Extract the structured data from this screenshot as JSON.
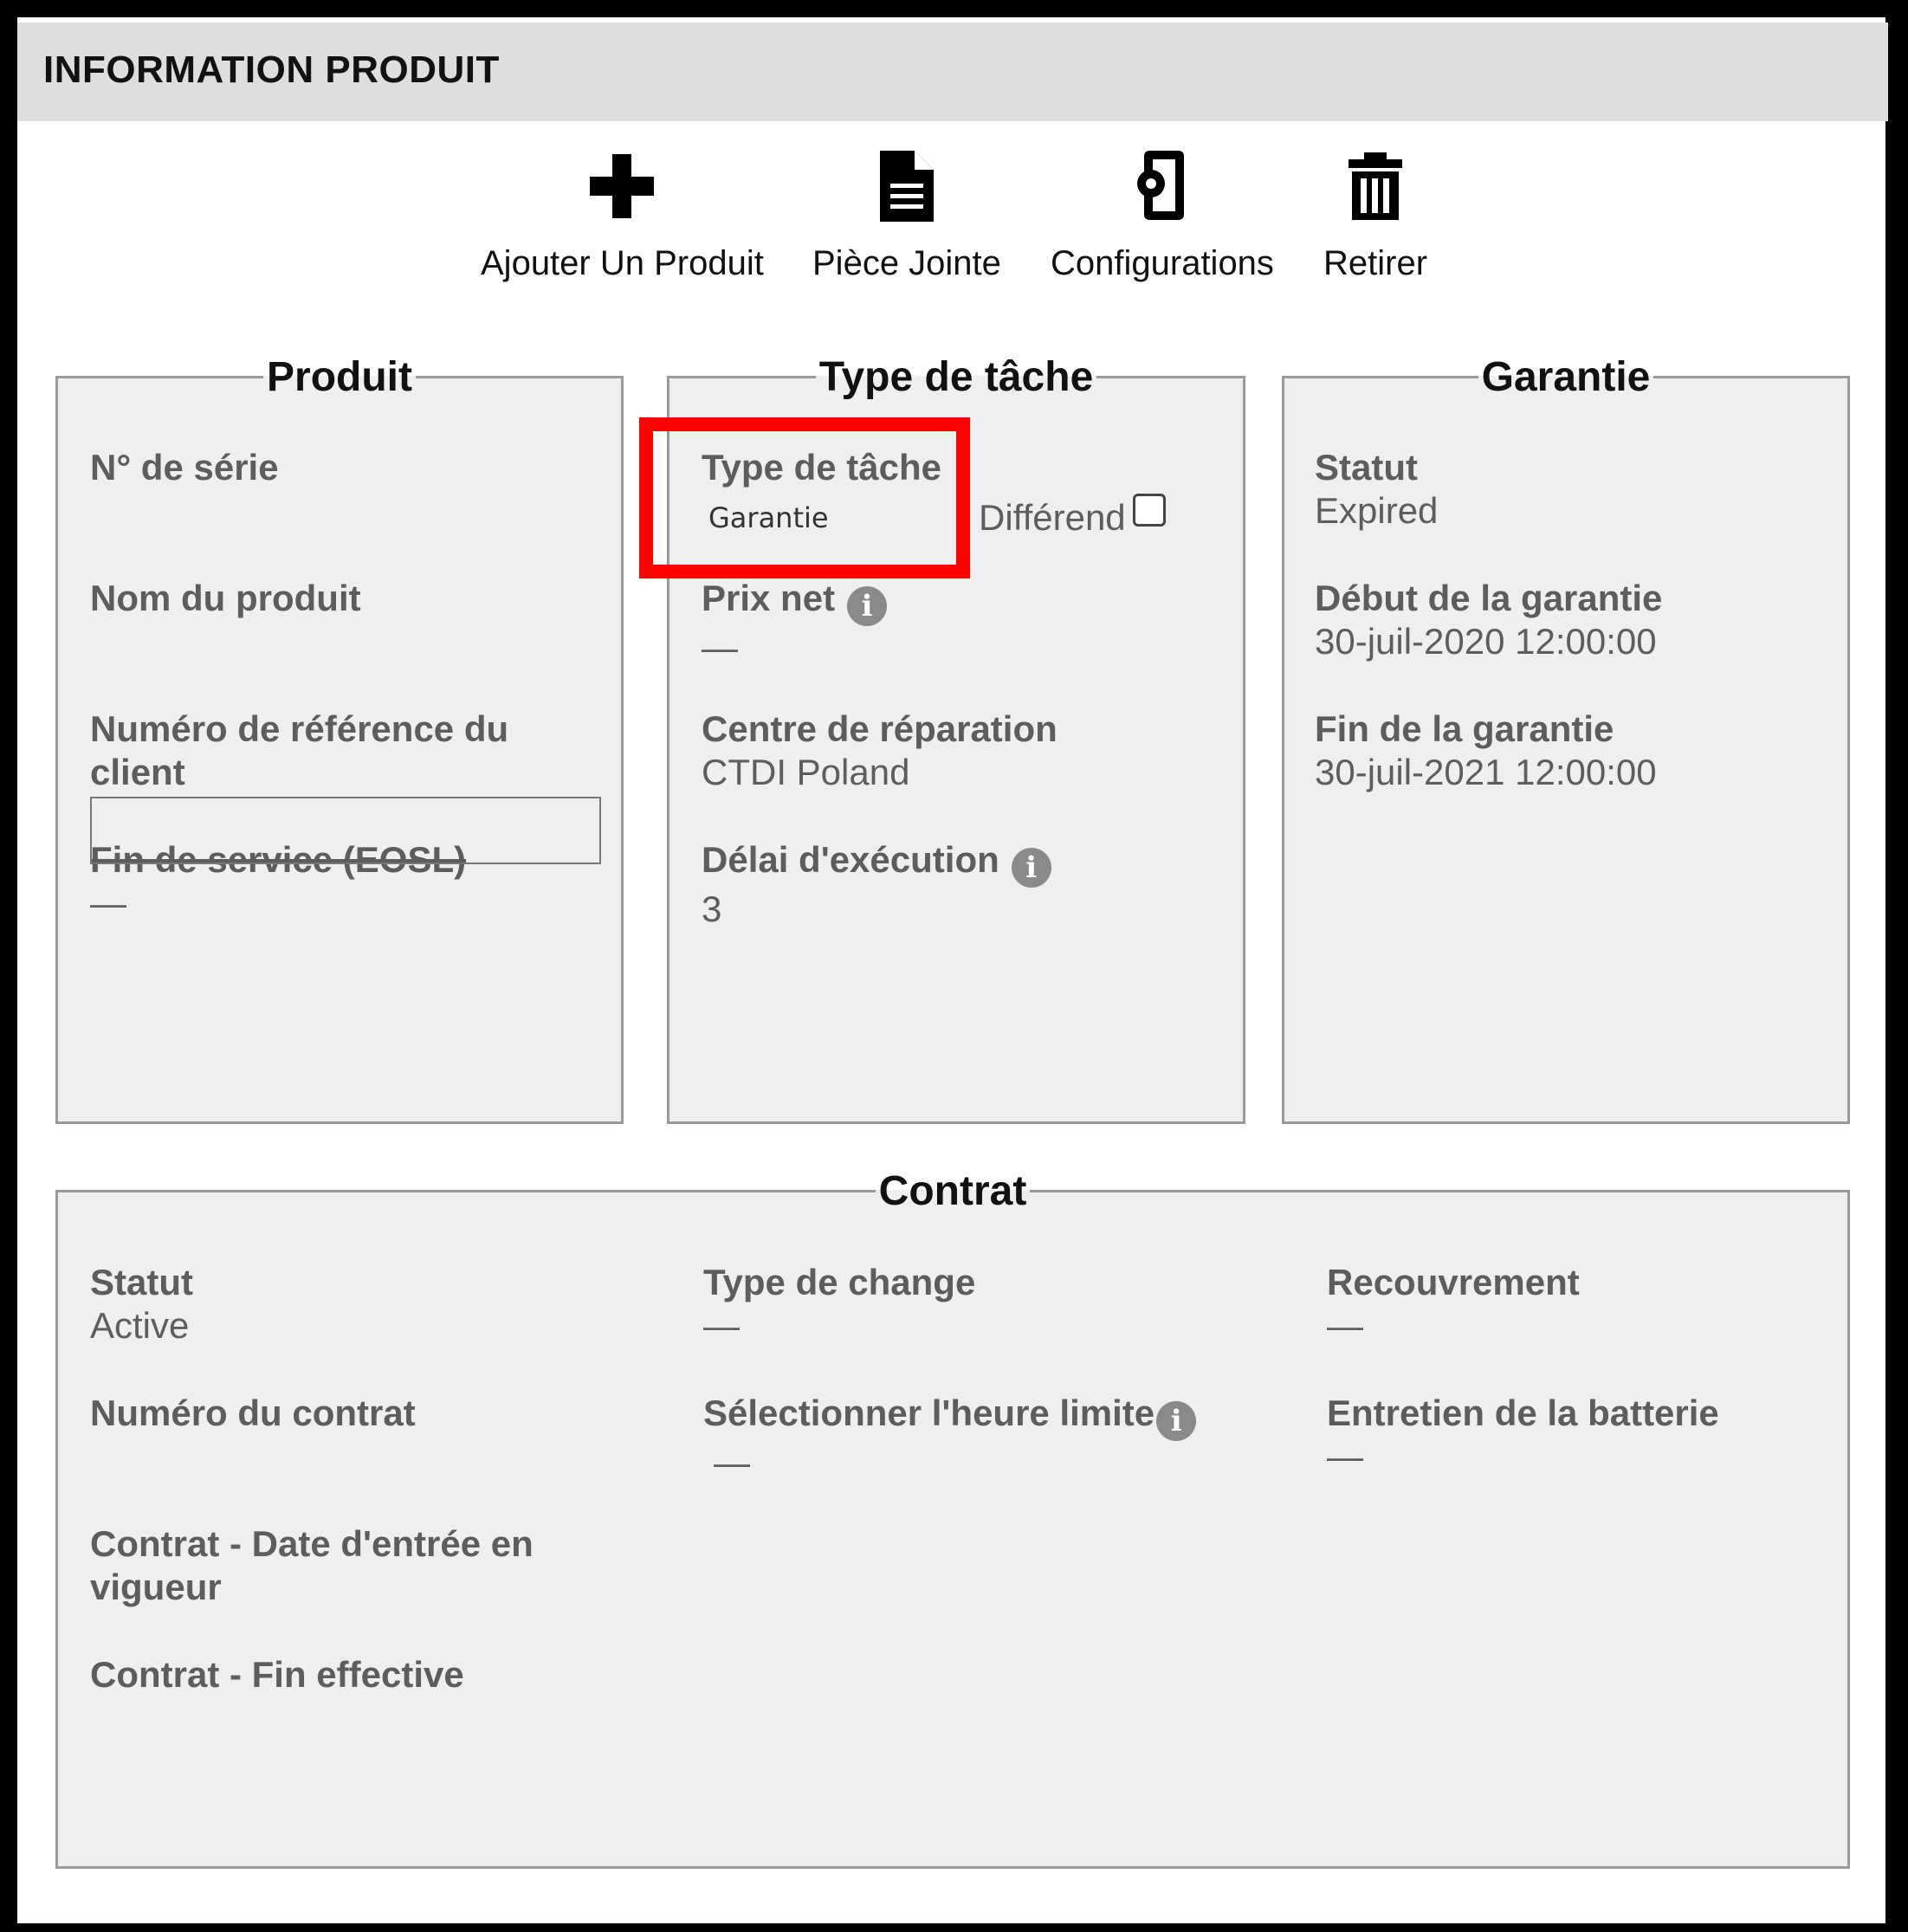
{
  "header": {
    "title": "INFORMATION PRODUIT"
  },
  "toolbar": {
    "add_label": "Ajouter Un Produit",
    "attachment_label": "Pièce Jointe",
    "config_label": "Configurations",
    "remove_label": "Retirer"
  },
  "produit": {
    "legend": "Produit",
    "serial_label": "N° de série",
    "name_label": "Nom du produit",
    "ref_label_line1": "Numéro de référence du",
    "ref_label_line2": "client",
    "ref_value": "",
    "eosl_label": "Fin de service (EOSL)",
    "eosl_value": "—"
  },
  "type_tache": {
    "legend": "Type de tâche",
    "type_label": "Type de tâche",
    "type_value": "Garantie",
    "differend_label": "Différend",
    "differend_checked": false,
    "prix_label": "Prix net",
    "prix_value": "—",
    "centre_label": "Centre de réparation",
    "centre_value": "CTDI Poland",
    "delai_label": "Délai d'exécution",
    "delai_value": "3"
  },
  "garantie": {
    "legend": "Garantie",
    "statut_label": "Statut",
    "statut_value": "Expired",
    "debut_label": "Début de la garantie",
    "debut_value": "30-juil-2020 12:00:00",
    "fin_label": "Fin de la garantie",
    "fin_value": "30-juil-2021 12:00:00"
  },
  "contrat": {
    "legend": "Contrat",
    "statut_label": "Statut",
    "statut_value": "Active",
    "numero_label": "Numéro du contrat",
    "date_entree_label_line1": "Contrat - Date d'entrée en",
    "date_entree_label_line2": "vigueur",
    "fin_effective_label": "Contrat - Fin effective",
    "type_change_label": "Type de change",
    "type_change_value": "—",
    "heure_limite_label": "Sélectionner l'heure limite",
    "heure_limite_value": "—",
    "recouvrement_label": "Recouvrement",
    "recouvrement_value": "—",
    "batterie_label": "Entretien de la batterie",
    "batterie_value": "—"
  },
  "colors": {
    "highlight": "#ff0000",
    "panel_bg": "#efefef",
    "header_bg": "#dedede"
  },
  "icons": [
    "plus-icon",
    "document-icon",
    "device-settings-icon",
    "trash-icon",
    "info-icon"
  ]
}
